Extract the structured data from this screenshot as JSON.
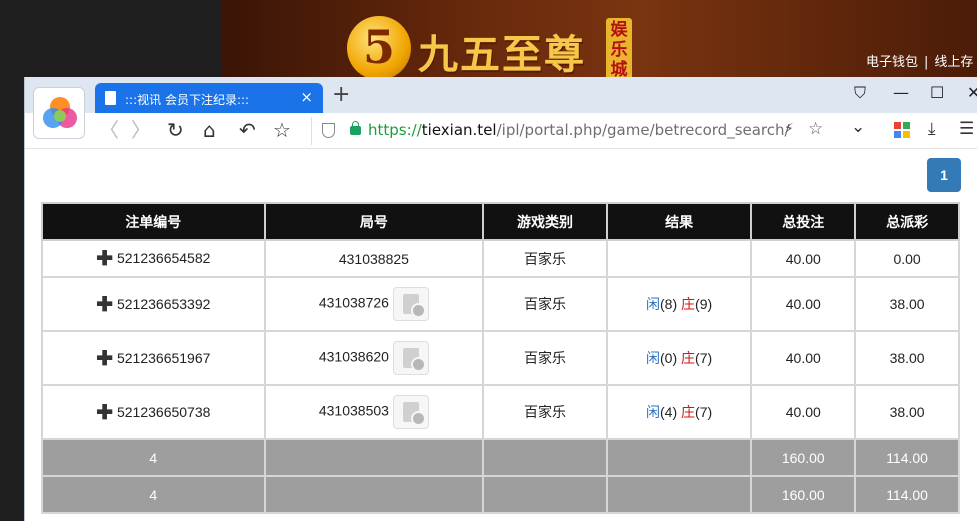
{
  "site": {
    "logo_glyph": "5",
    "logo_text": "九五至尊",
    "badge_text": "娱乐城",
    "links": [
      "电子钱包",
      "线上存"
    ],
    "link_sep": "|"
  },
  "tab": {
    "title": ":::视讯 会员下注纪录:::",
    "close": "×",
    "new": "+"
  },
  "window": {
    "skin": "⛉",
    "minimize": "—",
    "maximize": "☐",
    "close": "✕"
  },
  "nav": {
    "back": "〈",
    "forward": "〉",
    "reload": "↻",
    "home": "⌂",
    "undo": "↶",
    "favorite": "☆"
  },
  "address": {
    "scheme": "https://",
    "host": "tiexian.tel",
    "path": "/ipl/portal.php/game/betrecord_search/",
    "bolt": "⚡",
    "star": "☆",
    "dropdown": "⌄",
    "download": "⤓",
    "menu": "☰"
  },
  "pagination": {
    "current": "1"
  },
  "table": {
    "headers": [
      "注单编号",
      "局号",
      "游戏类别",
      "结果",
      "总投注",
      "总派彩"
    ],
    "expand_icon": "✚",
    "rows": [
      {
        "bet_id": "521236654582",
        "round": "431038825",
        "has_video": false,
        "game": "百家乐",
        "result": null,
        "stake": "40.00",
        "payout": "0.00"
      },
      {
        "bet_id": "521236653392",
        "round": "431038726",
        "has_video": true,
        "game": "百家乐",
        "result": {
          "player_label": "闲",
          "player": "(8)",
          "banker_label": "庄",
          "banker": "(9)"
        },
        "stake": "40.00",
        "payout": "38.00"
      },
      {
        "bet_id": "521236651967",
        "round": "431038620",
        "has_video": true,
        "game": "百家乐",
        "result": {
          "player_label": "闲",
          "player": "(0)",
          "banker_label": "庄",
          "banker": "(7)"
        },
        "stake": "40.00",
        "payout": "38.00"
      },
      {
        "bet_id": "521236650738",
        "round": "431038503",
        "has_video": true,
        "game": "百家乐",
        "result": {
          "player_label": "闲",
          "player": "(4)",
          "banker_label": "庄",
          "banker": "(7)"
        },
        "stake": "40.00",
        "payout": "38.00"
      }
    ],
    "subtotal": {
      "count": "4",
      "stake": "160.00",
      "payout": "114.00"
    },
    "total": {
      "count": "4",
      "stake": "160.00",
      "payout": "114.00"
    }
  },
  "colors": {
    "tab_active": "#1a73e8",
    "page_btn": "#337ab7",
    "header_bg": "#111111",
    "summary_bg": "#9e9e9e",
    "player": "#2f6fbf",
    "banker": "#d01515"
  }
}
